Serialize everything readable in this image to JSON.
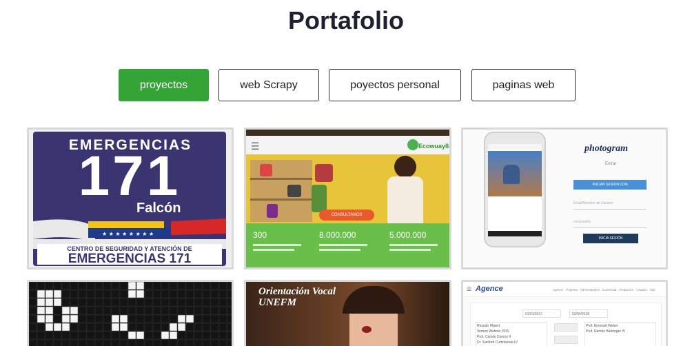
{
  "page": {
    "title": "Portafolio"
  },
  "filters": [
    {
      "label": "proyectos",
      "active": true
    },
    {
      "label": "web Scrapy",
      "active": false
    },
    {
      "label": "poyectos personal",
      "active": false
    },
    {
      "label": "paginas web",
      "active": false
    }
  ],
  "cards": {
    "emergencias": {
      "top_text": "EMERGENCIAS",
      "number": "171",
      "city": "Falcón",
      "subtitle": "CENTRO DE SEGURIDAD Y ATENCIÓN DE",
      "bottom_text": "EMERGENCIAS 171"
    },
    "ecowuaylla": {
      "brand": "Ecowuaylla",
      "cta": "CONSULTANOS",
      "stats": [
        "300",
        "8.000.000",
        "5.000.000"
      ]
    },
    "photogram": {
      "brand": "photogram",
      "subtitle": "Entrar",
      "login_button": "INICIAR SESION CON",
      "email_placeholder": "Email/Nombre de Usuario",
      "password_placeholder": "contraseña",
      "submit_button": "INICIA SESIÓN"
    },
    "orientacion": {
      "title_line1": "Orientación Vocal",
      "title_line2": "UNEFM"
    },
    "agence": {
      "brand": "Agence",
      "nav": [
        "Agence",
        "Projetos",
        "Administrativo",
        "Comercial",
        "Financeiro",
        "Usuário",
        "Sair"
      ],
      "date_from": "01/01/2017",
      "date_to": "02/04/2018",
      "consultants_left": [
        "Ricardo Hilpert",
        "Vernon Wehner DDS",
        "Prof. Camilo Conroy II",
        "Dr. Sanford Cummerata IV"
      ],
      "consultants_right": [
        "Prof. Emerald Weber",
        "Prof. Ramiro Bahringer IV"
      ]
    }
  },
  "colors": {
    "accent_green": "#35a436",
    "card_border": "#d9d9d9",
    "emergency_navy": "#3a3470",
    "photogram_blue": "#4a90d9"
  }
}
